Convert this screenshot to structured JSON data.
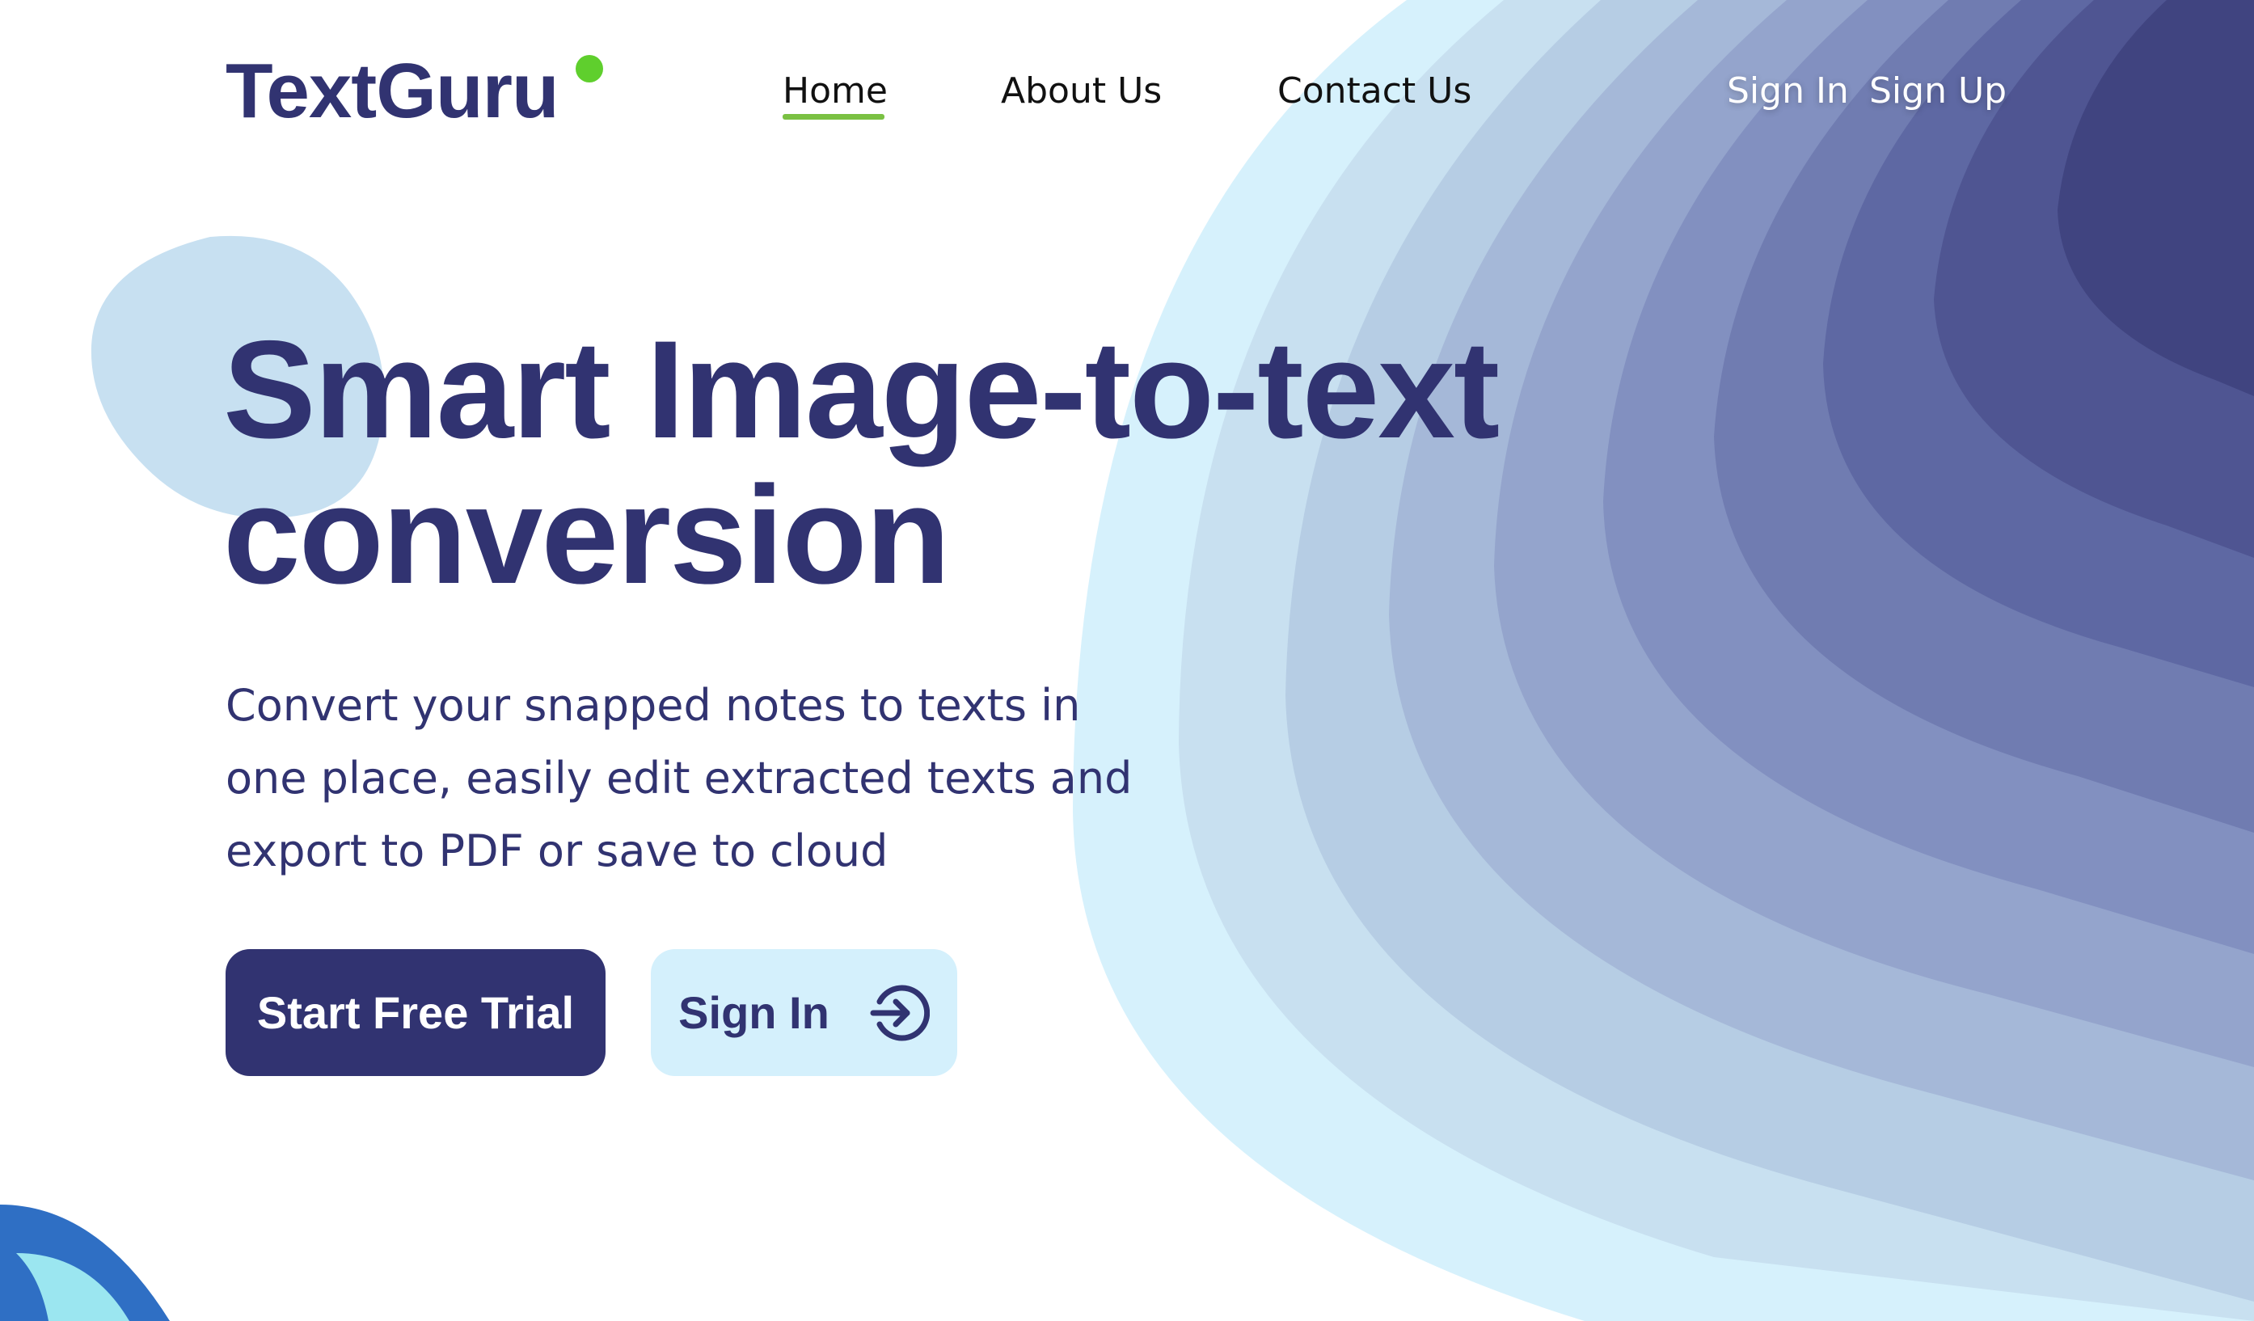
{
  "brand": {
    "name": "TextGuru",
    "accent_dot_color": "#5fcf2d"
  },
  "nav": {
    "items": [
      {
        "label": "Home",
        "active": true
      },
      {
        "label": "About Us",
        "active": false
      },
      {
        "label": "Contact Us",
        "active": false
      }
    ],
    "active_indicator_color": "#7ac143"
  },
  "auth": {
    "sign_in": "Sign In",
    "sign_up": "Sign Up"
  },
  "hero": {
    "title_lines": [
      "Smart Image-to-text",
      "conversion"
    ],
    "subtitle_lines": [
      "Convert your snapped notes to texts in",
      "one place, easily edit extracted texts and",
      "export to PDF or save to cloud"
    ],
    "primary_cta": "Start Free Trial",
    "secondary_cta": "Sign In",
    "secondary_cta_icon": "sign-in-arrow-icon"
  },
  "colors": {
    "primary": "#313371",
    "secondary_button_bg": "#d4f0fc",
    "blob": "#c7e0f1",
    "wave_layers": [
      "#d6f1fc",
      "#c8e0f0",
      "#b6cde4",
      "#a5b8d8",
      "#94a4cc",
      "#8290c0",
      "#707cb1",
      "#5e68a3",
      "#4f5592",
      "#404480"
    ]
  }
}
